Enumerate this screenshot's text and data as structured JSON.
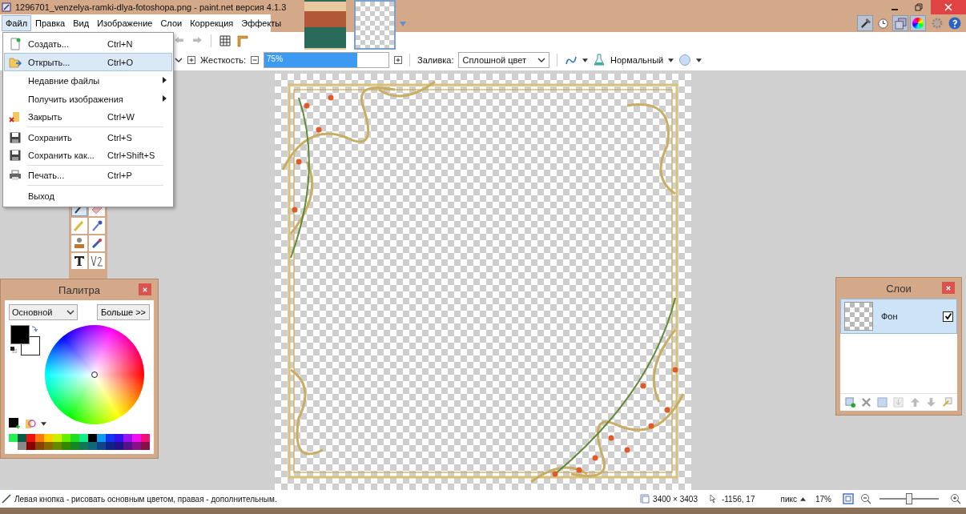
{
  "window": {
    "title": "1296701_venzelya-ramki-dlya-fotoshopa.png - paint.net версия 4.1.3"
  },
  "menu": [
    {
      "label": "Файл",
      "selected": true
    },
    {
      "label": "Правка",
      "selected": false
    },
    {
      "label": "Вид",
      "selected": false
    },
    {
      "label": "Изображение",
      "selected": false
    },
    {
      "label": "Слои",
      "selected": false
    },
    {
      "label": "Коррекция",
      "selected": false
    },
    {
      "label": "Эффекты",
      "selected": false
    }
  ],
  "document_tabs": [
    {
      "kind": "portrait",
      "selected": false
    },
    {
      "kind": "frame",
      "selected": true
    }
  ],
  "window_toggles": [
    {
      "kind": "tools",
      "selected": true
    },
    {
      "kind": "history",
      "selected": false
    },
    {
      "kind": "layers",
      "selected": true
    },
    {
      "kind": "colors",
      "selected": true
    }
  ],
  "file_menu": [
    {
      "kind": "new",
      "label": "Создать...",
      "shortcut": "Ctrl+N",
      "submenu": false,
      "selected": false,
      "divider_after": false
    },
    {
      "kind": "open",
      "label": "Открыть...",
      "shortcut": "Ctrl+O",
      "submenu": false,
      "selected": true,
      "divider_after": false
    },
    {
      "kind": "plain",
      "label": "Недавние файлы",
      "submenu": true,
      "selected": false,
      "divider_after": false
    },
    {
      "kind": "plain",
      "label": "Получить изображения",
      "submenu": true,
      "selected": false,
      "divider_after": false
    },
    {
      "kind": "close",
      "label": "Закрыть",
      "shortcut": "Ctrl+W",
      "submenu": false,
      "selected": false,
      "divider_after": true
    },
    {
      "kind": "save",
      "label": "Сохранить",
      "shortcut": "Ctrl+S",
      "submenu": false,
      "selected": false,
      "divider_after": false
    },
    {
      "kind": "save",
      "label": "Сохранить как...",
      "shortcut": "Ctrl+Shift+S",
      "submenu": false,
      "selected": false,
      "divider_after": true
    },
    {
      "kind": "print",
      "label": "Печать...",
      "shortcut": "Ctrl+P",
      "submenu": false,
      "selected": false,
      "divider_after": true
    },
    {
      "kind": "plain",
      "label": "Выход",
      "submenu": false,
      "selected": false,
      "divider_after": false
    }
  ],
  "options": {
    "hardness_label": "Жесткость:",
    "hardness_slider": {
      "value": "75%",
      "level": 0.75
    },
    "fill_label": "Заливка:",
    "fill_value": "Сплошной цвет",
    "blend_mode": "Нормальный"
  },
  "tools": [
    {
      "kind": "brush",
      "selected": true
    },
    {
      "kind": "eraser",
      "selected": false
    },
    {
      "kind": "pencil",
      "selected": false
    },
    {
      "kind": "picker",
      "selected": false
    },
    {
      "kind": "stamp",
      "selected": false
    },
    {
      "kind": "recolor",
      "selected": false
    },
    {
      "kind": "text",
      "selected": false
    },
    {
      "kind": "line",
      "selected": false
    }
  ],
  "palette": {
    "title": "Палитра",
    "mode": "Основной",
    "more_button": "Больше >>"
  },
  "layers": {
    "title": "Слои",
    "items": [
      {
        "name": "Фон",
        "selected": true,
        "visible": true
      }
    ]
  },
  "status_bar": {
    "hint": "Левая кнопка - рисовать основным цветом, правая - дополнительным.",
    "size": "3400 × 3403",
    "cursor": "-1156, 17",
    "units": "пикс",
    "zoom": "17%",
    "zoom_slider": {
      "level": 0.5
    }
  }
}
